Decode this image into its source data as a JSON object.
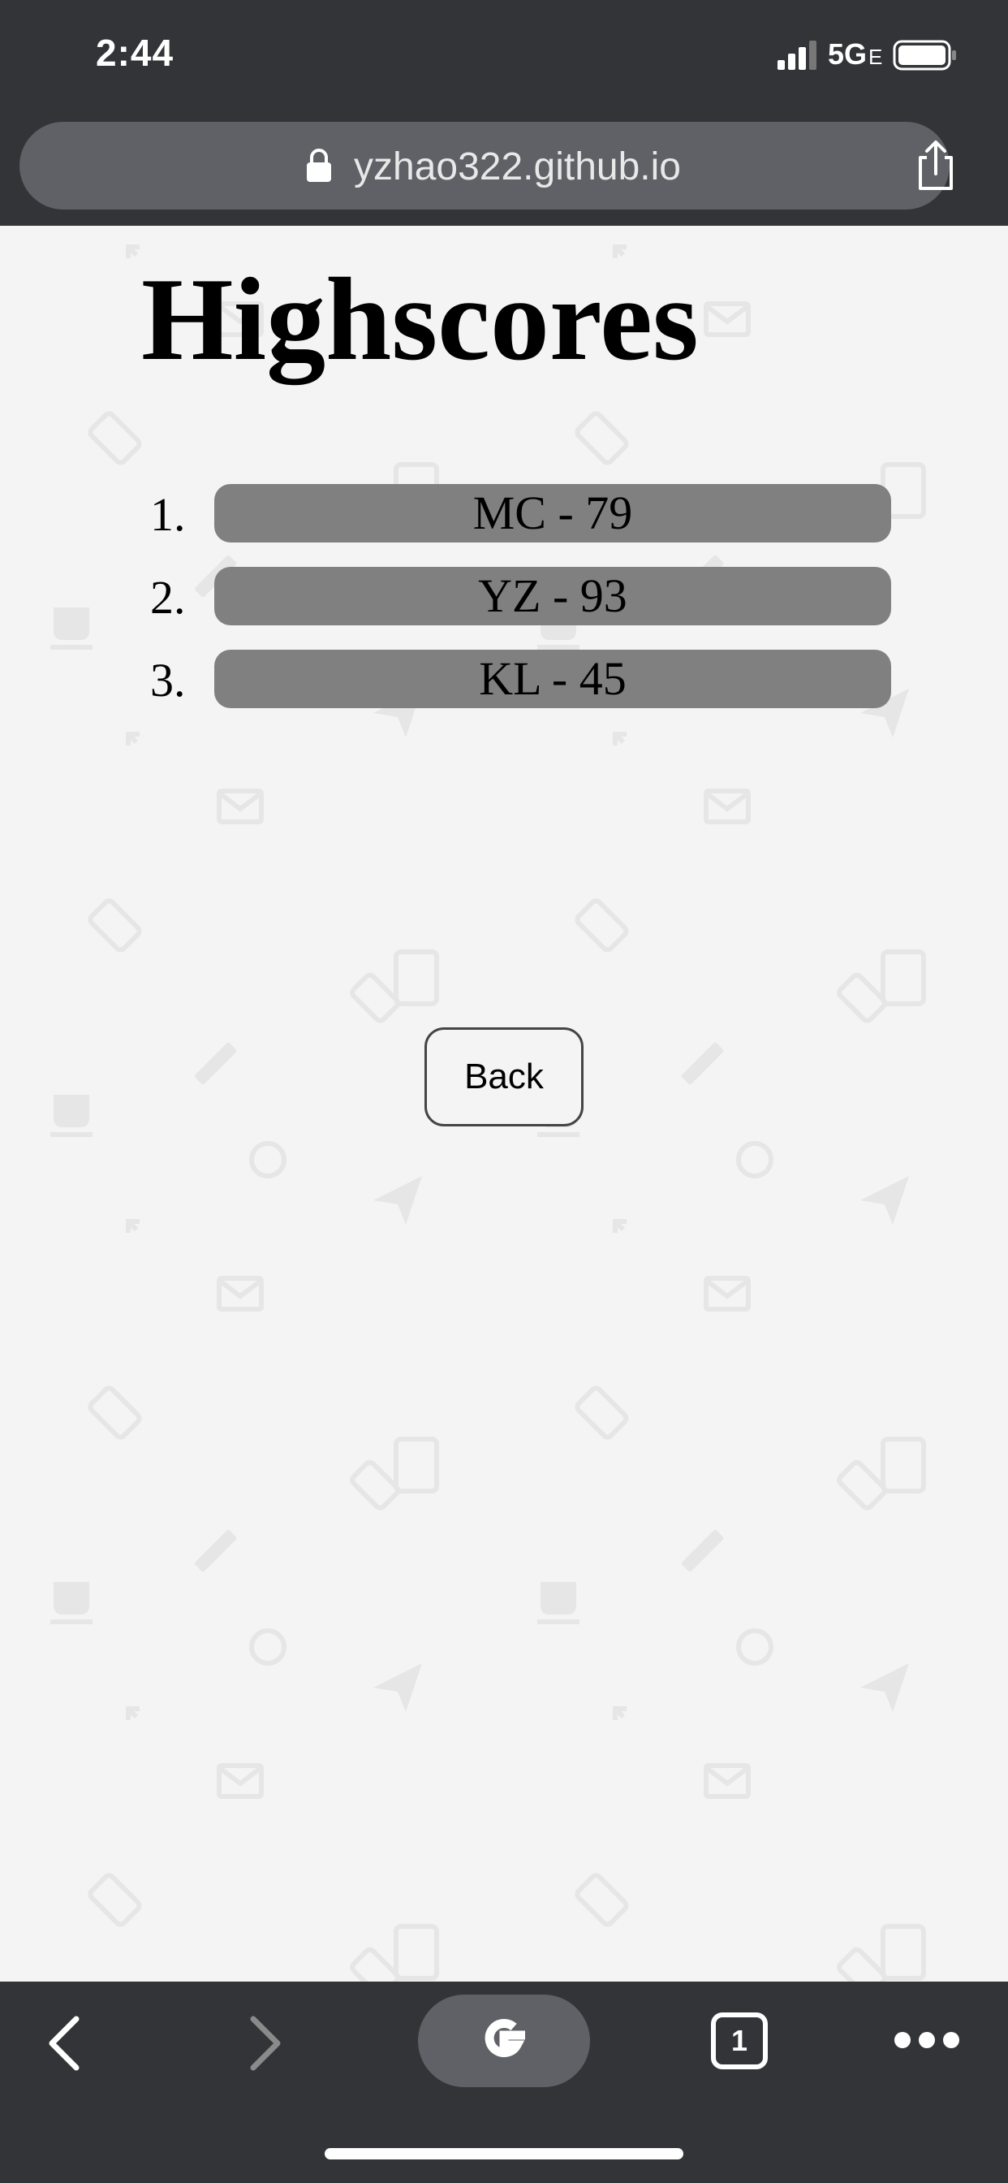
{
  "status_bar": {
    "time": "2:44",
    "network": "5G",
    "network_suffix": "E"
  },
  "url_bar": {
    "url": "yzhao322.github.io"
  },
  "page": {
    "title": "Highscores",
    "scores": [
      {
        "rank": "1.",
        "entry": "MC - 79"
      },
      {
        "rank": "2.",
        "entry": "YZ - 93"
      },
      {
        "rank": "3.",
        "entry": "KL - 45"
      }
    ],
    "back_label": "Back"
  },
  "toolbar": {
    "tab_count": "1"
  },
  "icons": {
    "lock": "lock-icon",
    "share": "share-icon",
    "back": "chevron-left-icon",
    "forward": "chevron-right-icon",
    "google": "google-icon",
    "tabs": "tabs-icon",
    "more": "more-icon"
  },
  "colors": {
    "chrome_bg": "#333437",
    "pill_bg": "#5f6166",
    "page_bg": "#f4f4f4",
    "score_bar": "#808080"
  }
}
